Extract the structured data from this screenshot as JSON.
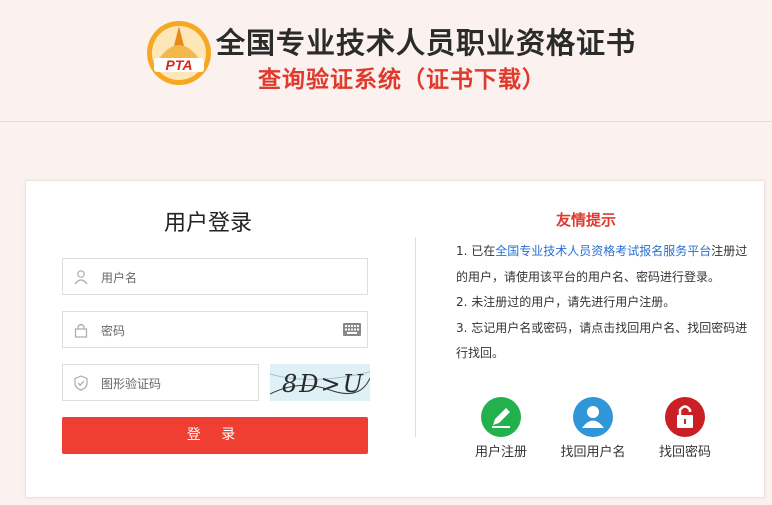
{
  "header": {
    "logo_text": "PTA",
    "title": "全国专业技术人员职业资格证书",
    "subtitle": "查询验证系统（证书下载）"
  },
  "login": {
    "title": "用户登录",
    "username_placeholder": "用户名",
    "password_placeholder": "密码",
    "captcha_placeholder": "图形验证码",
    "captcha_text": "8D>U",
    "submit_label": "登 录"
  },
  "tips": {
    "title": "友情提示",
    "item1_prefix": "1. 已在",
    "item1_link": "全国专业技术人员资格考试报名服务平台",
    "item1_suffix": "注册过的用户，请使用该平台的用户名、密码进行登录。",
    "item2": "2. 未注册过的用户，请先进行用户注册。",
    "item3": "3. 忘记用户名或密码，请点击找回用户名、找回密码进行找回。"
  },
  "actions": [
    {
      "label": "用户注册",
      "icon": "pencil-icon",
      "color": "#22b14c"
    },
    {
      "label": "找回用户名",
      "icon": "user-icon",
      "color": "#2f97d7"
    },
    {
      "label": "找回密码",
      "icon": "lock-icon",
      "color": "#c91f25"
    }
  ],
  "colors": {
    "accent": "#ef3e32",
    "link": "#2a6fd1"
  }
}
